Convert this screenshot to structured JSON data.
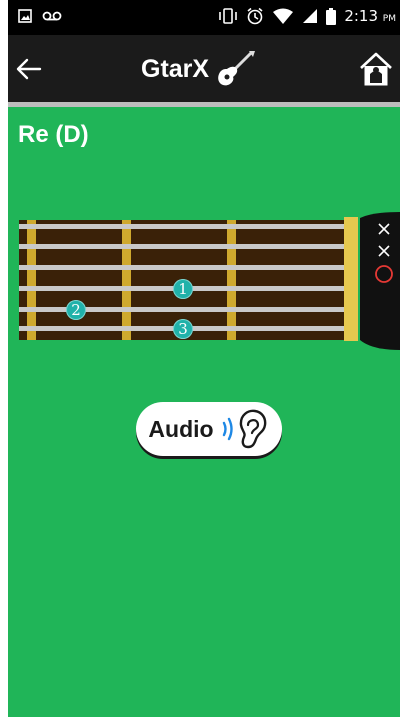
{
  "status_bar": {
    "time": "2:13",
    "ampm": "PM",
    "icons": [
      "image-icon",
      "voicemail-icon",
      "vibrate-icon",
      "alarm-icon",
      "wifi-icon",
      "signal-icon",
      "battery-icon"
    ]
  },
  "app_bar": {
    "title": "GtarX",
    "icons": [
      "back-arrow-icon",
      "guitar-icon",
      "home-icon"
    ]
  },
  "chord": {
    "name": "Re (D)",
    "fingers": [
      {
        "number": "1"
      },
      {
        "number": "2"
      },
      {
        "number": "3"
      }
    ],
    "string_markers": [
      "×",
      "×",
      "○"
    ]
  },
  "audio_button": {
    "label": "Audio",
    "icon": "ear-sound-icon"
  },
  "colors": {
    "background": "#20b558",
    "app_bar": "#1b1b1b",
    "fretboard": "#3a2108",
    "finger_dot": "#20b2aa",
    "marker_red": "#e53935"
  }
}
